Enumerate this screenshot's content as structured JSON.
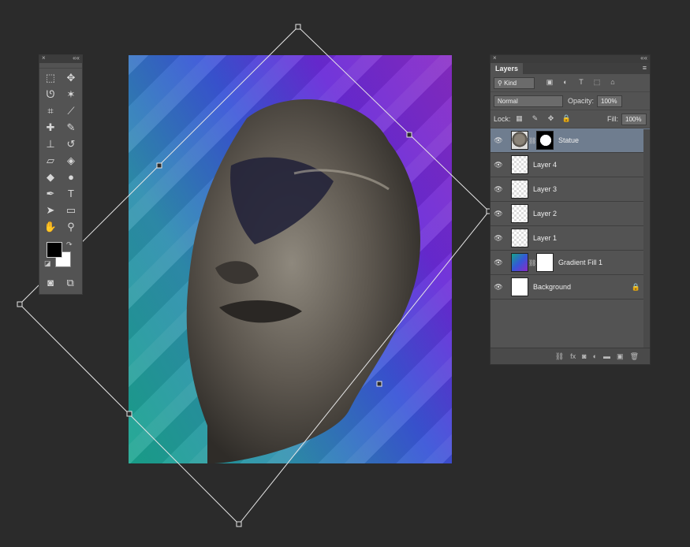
{
  "canvas": {
    "image": "statue-face-on-gradient",
    "colors": {
      "grad_a": "#1aa58e",
      "grad_b": "#3a56d8",
      "grad_c": "#8a2cc6"
    }
  },
  "tools_panel": {
    "close": "×",
    "collapse": "««",
    "tools": [
      {
        "name": "marquee-icon",
        "glyph": "⬚"
      },
      {
        "name": "move-icon",
        "glyph": "✥"
      },
      {
        "name": "lasso-icon",
        "glyph": "ᘎ"
      },
      {
        "name": "magic-wand-icon",
        "glyph": "✶"
      },
      {
        "name": "crop-icon",
        "glyph": "⌗"
      },
      {
        "name": "eyedropper-icon",
        "glyph": "⟋"
      },
      {
        "name": "healing-brush-icon",
        "glyph": "✚"
      },
      {
        "name": "brush-icon",
        "glyph": "✎"
      },
      {
        "name": "clone-stamp-icon",
        "glyph": "⊥"
      },
      {
        "name": "history-brush-icon",
        "glyph": "↺"
      },
      {
        "name": "eraser-icon",
        "glyph": "▱"
      },
      {
        "name": "paint-bucket-icon",
        "glyph": "◈"
      },
      {
        "name": "blur-icon",
        "glyph": "◆"
      },
      {
        "name": "dodge-icon",
        "glyph": "●"
      },
      {
        "name": "pen-icon",
        "glyph": "✒"
      },
      {
        "name": "type-icon",
        "glyph": "T"
      },
      {
        "name": "path-selection-icon",
        "glyph": "➤"
      },
      {
        "name": "rectangle-icon",
        "glyph": "▭"
      },
      {
        "name": "hand-icon",
        "glyph": "✋"
      },
      {
        "name": "zoom-icon",
        "glyph": "⚲"
      }
    ],
    "swap_glyph": "↷",
    "default_glyph": "◪",
    "quickmask_glyph": "◙",
    "screenmode_glyph": "⧉"
  },
  "layers_panel": {
    "close": "×",
    "collapse": "««",
    "tab_label": "Layers",
    "menu_glyph": "≡",
    "filter_label": "Kind",
    "filter_glyph": "⚲",
    "filter_icons": [
      "▣",
      "◐",
      "T",
      "⬚",
      "⌂"
    ],
    "blend_mode": "Normal",
    "opacity_label": "Opacity:",
    "opacity_value": "100%",
    "lock_label": "Lock:",
    "lock_icons": [
      "▦",
      "✎",
      "✥",
      "🔒"
    ],
    "fill_label": "Fill:",
    "fill_value": "100%",
    "eye_glyph": "👁",
    "lock_glyph": "🔒",
    "chain_glyph": "⛓",
    "layers": [
      {
        "name": "Statue",
        "selected": true,
        "thumb": "statue",
        "mask": "mask-statue"
      },
      {
        "name": "Layer 4",
        "selected": false,
        "thumb": "transparent"
      },
      {
        "name": "Layer 3",
        "selected": false,
        "thumb": "transparent"
      },
      {
        "name": "Layer 2",
        "selected": false,
        "thumb": "transparent"
      },
      {
        "name": "Layer 1",
        "selected": false,
        "thumb": "transparent"
      },
      {
        "name": "Gradient Fill 1",
        "selected": false,
        "thumb": "grad",
        "mask": "mask"
      },
      {
        "name": "Background",
        "selected": false,
        "thumb": "white",
        "locked": true
      }
    ],
    "footer_icons": [
      "⛓",
      "fx",
      "◙",
      "◐",
      "▬",
      "▣",
      "🗑"
    ]
  }
}
